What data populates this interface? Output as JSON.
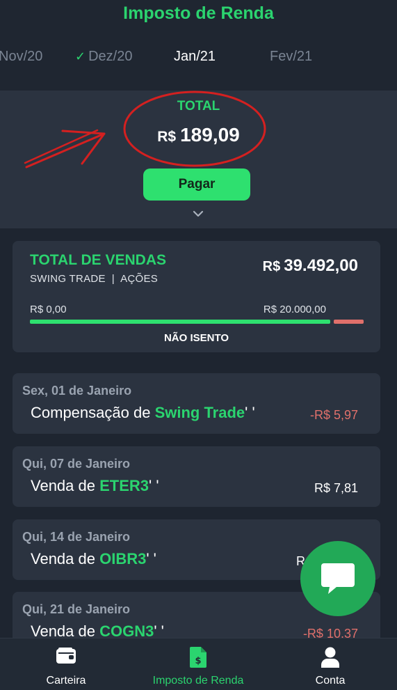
{
  "header": {
    "title": "Imposto de Renda",
    "months": [
      {
        "label": "Nov/20",
        "checked": false,
        "active": false
      },
      {
        "label": "Dez/20",
        "checked": true,
        "active": false
      },
      {
        "label": "Jan/21",
        "checked": false,
        "active": true
      },
      {
        "label": "Fev/21",
        "checked": false,
        "active": false
      }
    ]
  },
  "total": {
    "label": "TOTAL",
    "currency": "R$",
    "value": "189,09",
    "pay_label": "Pagar"
  },
  "sales": {
    "title": "TOTAL DE VENDAS",
    "subtitle": "SWING TRADE  |  AÇÕES",
    "currency": "R$",
    "amount": "39.492,00",
    "range_min": "R$ 0,00",
    "range_max": "R$ 20.000,00",
    "status": "NÃO ISENTO"
  },
  "transactions": [
    {
      "date": "Sex, 01 de Janeiro",
      "prefix": "Compensação de ",
      "highlight": "Swing Trade",
      "suffix": "' '",
      "amount": "-R$ 5,97",
      "negative": true
    },
    {
      "date": "Qui, 07 de Janeiro",
      "prefix": "Venda de ",
      "highlight": "ETER3",
      "suffix": "' '",
      "amount": "R$ 7,81",
      "negative": false
    },
    {
      "date": "Qui, 14 de Janeiro",
      "prefix": "Venda de ",
      "highlight": "OIBR3",
      "suffix": "' '",
      "amount": "R",
      "negative": false
    },
    {
      "date": "Qui, 21 de Janeiro",
      "prefix": "Venda de ",
      "highlight": "COGN3",
      "suffix": "' '",
      "amount": "-R$ 10,37",
      "negative": true
    }
  ],
  "nav": {
    "items": [
      {
        "label": "Carteira",
        "icon": "wallet-icon",
        "active": false
      },
      {
        "label": "Imposto de Renda",
        "icon": "tax-document-icon",
        "active": true
      },
      {
        "label": "Conta",
        "icon": "user-icon",
        "active": false
      }
    ]
  },
  "colors": {
    "accent": "#2bd46f",
    "background": "#1e2530",
    "card": "#2b3340",
    "negative": "#e0706b",
    "annotation": "#d42020"
  }
}
